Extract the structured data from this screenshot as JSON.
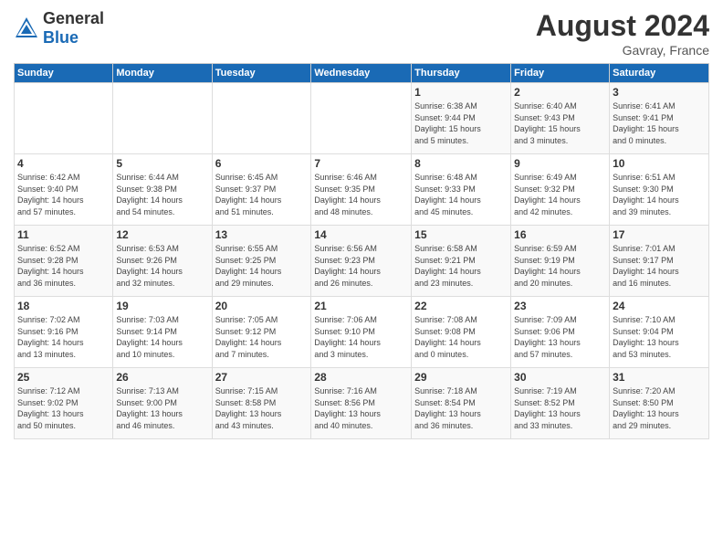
{
  "header": {
    "logo_general": "General",
    "logo_blue": "Blue",
    "month_year": "August 2024",
    "location": "Gavray, France"
  },
  "days_of_week": [
    "Sunday",
    "Monday",
    "Tuesday",
    "Wednesday",
    "Thursday",
    "Friday",
    "Saturday"
  ],
  "weeks": [
    [
      {
        "day": "",
        "info": ""
      },
      {
        "day": "",
        "info": ""
      },
      {
        "day": "",
        "info": ""
      },
      {
        "day": "",
        "info": ""
      },
      {
        "day": "1",
        "info": "Sunrise: 6:38 AM\nSunset: 9:44 PM\nDaylight: 15 hours\nand 5 minutes."
      },
      {
        "day": "2",
        "info": "Sunrise: 6:40 AM\nSunset: 9:43 PM\nDaylight: 15 hours\nand 3 minutes."
      },
      {
        "day": "3",
        "info": "Sunrise: 6:41 AM\nSunset: 9:41 PM\nDaylight: 15 hours\nand 0 minutes."
      }
    ],
    [
      {
        "day": "4",
        "info": "Sunrise: 6:42 AM\nSunset: 9:40 PM\nDaylight: 14 hours\nand 57 minutes."
      },
      {
        "day": "5",
        "info": "Sunrise: 6:44 AM\nSunset: 9:38 PM\nDaylight: 14 hours\nand 54 minutes."
      },
      {
        "day": "6",
        "info": "Sunrise: 6:45 AM\nSunset: 9:37 PM\nDaylight: 14 hours\nand 51 minutes."
      },
      {
        "day": "7",
        "info": "Sunrise: 6:46 AM\nSunset: 9:35 PM\nDaylight: 14 hours\nand 48 minutes."
      },
      {
        "day": "8",
        "info": "Sunrise: 6:48 AM\nSunset: 9:33 PM\nDaylight: 14 hours\nand 45 minutes."
      },
      {
        "day": "9",
        "info": "Sunrise: 6:49 AM\nSunset: 9:32 PM\nDaylight: 14 hours\nand 42 minutes."
      },
      {
        "day": "10",
        "info": "Sunrise: 6:51 AM\nSunset: 9:30 PM\nDaylight: 14 hours\nand 39 minutes."
      }
    ],
    [
      {
        "day": "11",
        "info": "Sunrise: 6:52 AM\nSunset: 9:28 PM\nDaylight: 14 hours\nand 36 minutes."
      },
      {
        "day": "12",
        "info": "Sunrise: 6:53 AM\nSunset: 9:26 PM\nDaylight: 14 hours\nand 32 minutes."
      },
      {
        "day": "13",
        "info": "Sunrise: 6:55 AM\nSunset: 9:25 PM\nDaylight: 14 hours\nand 29 minutes."
      },
      {
        "day": "14",
        "info": "Sunrise: 6:56 AM\nSunset: 9:23 PM\nDaylight: 14 hours\nand 26 minutes."
      },
      {
        "day": "15",
        "info": "Sunrise: 6:58 AM\nSunset: 9:21 PM\nDaylight: 14 hours\nand 23 minutes."
      },
      {
        "day": "16",
        "info": "Sunrise: 6:59 AM\nSunset: 9:19 PM\nDaylight: 14 hours\nand 20 minutes."
      },
      {
        "day": "17",
        "info": "Sunrise: 7:01 AM\nSunset: 9:17 PM\nDaylight: 14 hours\nand 16 minutes."
      }
    ],
    [
      {
        "day": "18",
        "info": "Sunrise: 7:02 AM\nSunset: 9:16 PM\nDaylight: 14 hours\nand 13 minutes."
      },
      {
        "day": "19",
        "info": "Sunrise: 7:03 AM\nSunset: 9:14 PM\nDaylight: 14 hours\nand 10 minutes."
      },
      {
        "day": "20",
        "info": "Sunrise: 7:05 AM\nSunset: 9:12 PM\nDaylight: 14 hours\nand 7 minutes."
      },
      {
        "day": "21",
        "info": "Sunrise: 7:06 AM\nSunset: 9:10 PM\nDaylight: 14 hours\nand 3 minutes."
      },
      {
        "day": "22",
        "info": "Sunrise: 7:08 AM\nSunset: 9:08 PM\nDaylight: 14 hours\nand 0 minutes."
      },
      {
        "day": "23",
        "info": "Sunrise: 7:09 AM\nSunset: 9:06 PM\nDaylight: 13 hours\nand 57 minutes."
      },
      {
        "day": "24",
        "info": "Sunrise: 7:10 AM\nSunset: 9:04 PM\nDaylight: 13 hours\nand 53 minutes."
      }
    ],
    [
      {
        "day": "25",
        "info": "Sunrise: 7:12 AM\nSunset: 9:02 PM\nDaylight: 13 hours\nand 50 minutes."
      },
      {
        "day": "26",
        "info": "Sunrise: 7:13 AM\nSunset: 9:00 PM\nDaylight: 13 hours\nand 46 minutes."
      },
      {
        "day": "27",
        "info": "Sunrise: 7:15 AM\nSunset: 8:58 PM\nDaylight: 13 hours\nand 43 minutes."
      },
      {
        "day": "28",
        "info": "Sunrise: 7:16 AM\nSunset: 8:56 PM\nDaylight: 13 hours\nand 40 minutes."
      },
      {
        "day": "29",
        "info": "Sunrise: 7:18 AM\nSunset: 8:54 PM\nDaylight: 13 hours\nand 36 minutes."
      },
      {
        "day": "30",
        "info": "Sunrise: 7:19 AM\nSunset: 8:52 PM\nDaylight: 13 hours\nand 33 minutes."
      },
      {
        "day": "31",
        "info": "Sunrise: 7:20 AM\nSunset: 8:50 PM\nDaylight: 13 hours\nand 29 minutes."
      }
    ]
  ]
}
